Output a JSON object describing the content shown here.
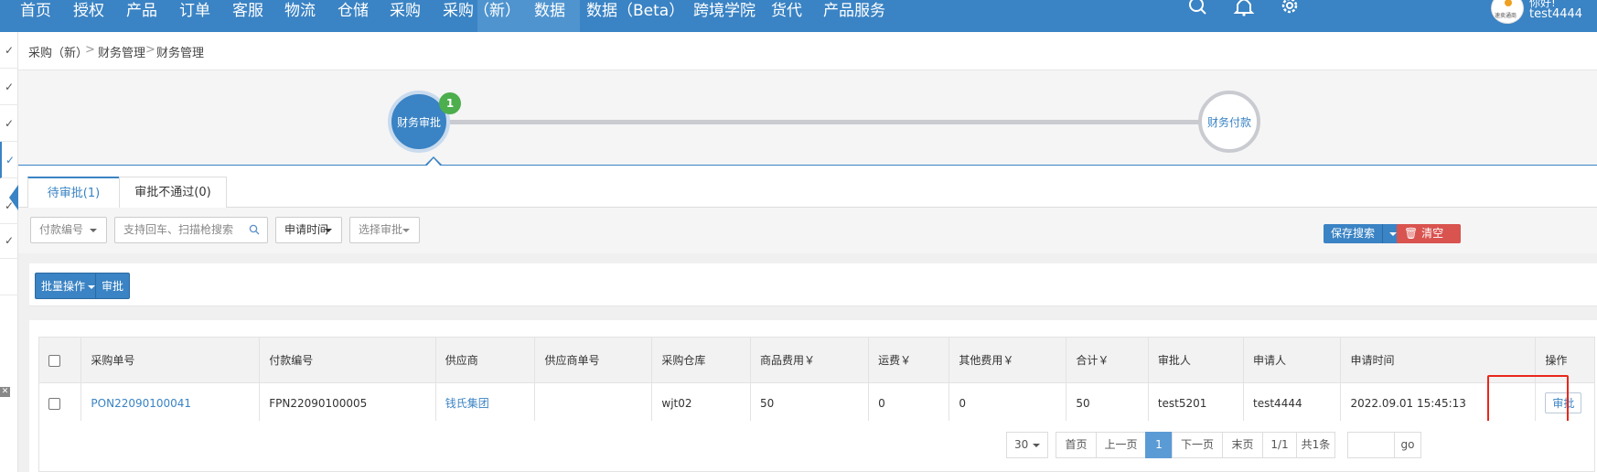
{
  "topnav": {
    "items": [
      "首页",
      "授权",
      "产品",
      "订单",
      "客服",
      "物流",
      "仓储",
      "采购",
      "采购（新）",
      "数据",
      "数据（Beta）",
      "跨境学院",
      "货代",
      "产品服务"
    ],
    "active_index": 8,
    "greeting": "你好!",
    "username": "test4444",
    "icons": [
      "search-icon",
      "bell-icon",
      "gear-icon"
    ]
  },
  "breadcrumb": {
    "items": [
      "采购（新）",
      "财务管理",
      "财务管理"
    ],
    "separator": ">"
  },
  "steps": [
    {
      "label": "财务审批",
      "badge": "1",
      "active": true
    },
    {
      "label": "财务付款",
      "active": false
    }
  ],
  "tabs": [
    {
      "label": "待审批(1)",
      "active": true
    },
    {
      "label": "审批不通过(0)",
      "active": false
    }
  ],
  "filters": {
    "payment_no_select": "付款编号",
    "search_placeholder": "支持回车、扫描枪搜索",
    "apply_time": "申请时间",
    "approver_select": "选择审批",
    "save_search": "保存搜索",
    "clear": "清空"
  },
  "actions": {
    "batch": "批量操作",
    "approve": "审批"
  },
  "table": {
    "headers": [
      "采购单号",
      "付款编号",
      "供应商",
      "供应商单号",
      "采购仓库",
      "商品费用￥",
      "运费￥",
      "其他费用￥",
      "合计￥",
      "审批人",
      "申请人",
      "申请时间",
      "操作"
    ],
    "rows": [
      {
        "po_no": "PON22090100041",
        "payment_no": "FPN22090100005",
        "supplier": "钱氏集团",
        "supplier_no": "",
        "warehouse": "wjt02",
        "goods_fee": "50",
        "freight": "0",
        "other_fee": "0",
        "total": "50",
        "approver": "test5201",
        "applicant": "test4444",
        "apply_time": "2022.09.01 15:45:13",
        "action": "审批"
      }
    ]
  },
  "pagination": {
    "page_size": "30",
    "first": "首页",
    "prev": "上一页",
    "current": "1",
    "next": "下一页",
    "last": "末页",
    "page_info": "1/1",
    "total": "共1条",
    "go": "go"
  },
  "colors": {
    "primary": "#3a83c4",
    "success": "#4cae4c",
    "danger": "#d9534f",
    "highlight": "#e8271b"
  }
}
